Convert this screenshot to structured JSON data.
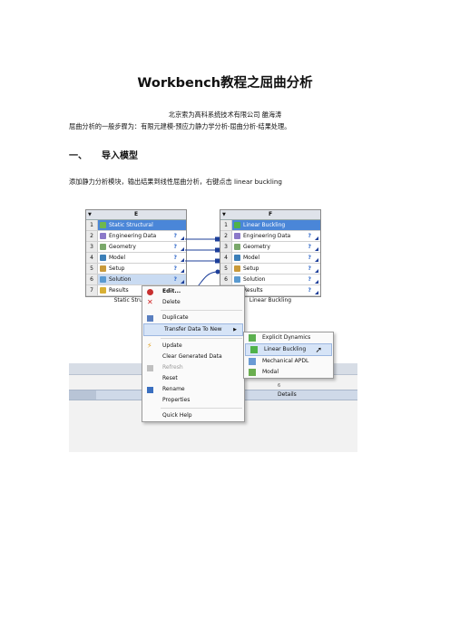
{
  "doc": {
    "title": "Workbench教程之屈曲分析",
    "author": "北京索为高科系统技术有限公司  雒海涛",
    "intro": "屈曲分析的一般步骤为：有限元建模-预应力静力学分析-屈曲分析-结果处理。",
    "section_num": "一、",
    "section_title": "导入模型",
    "para_cn": "添加静力分析模块，输出结果到线性屈曲分析，右键点击 ",
    "para_en": "linear buckling"
  },
  "screenshot": {
    "system_e": {
      "col_label": "E",
      "caption": "Static Structural",
      "rows": [
        {
          "n": "1",
          "label": "Static Structural",
          "status": ""
        },
        {
          "n": "2",
          "label": "Engineering Data",
          "status": "?"
        },
        {
          "n": "3",
          "label": "Geometry",
          "status": "?"
        },
        {
          "n": "4",
          "label": "Model",
          "status": "?"
        },
        {
          "n": "5",
          "label": "Setup",
          "status": "?"
        },
        {
          "n": "6",
          "label": "Solution",
          "status": "?"
        },
        {
          "n": "7",
          "label": "Results",
          "status": "?"
        }
      ]
    },
    "system_f": {
      "col_label": "F",
      "caption": "Linear Buckling",
      "rows": [
        {
          "n": "1",
          "label": "Linear Buckling",
          "status": ""
        },
        {
          "n": "2",
          "label": "Engineering Data",
          "status": "?"
        },
        {
          "n": "3",
          "label": "Geometry",
          "status": "?"
        },
        {
          "n": "4",
          "label": "Model",
          "status": "?"
        },
        {
          "n": "5",
          "label": "Setup",
          "status": "?"
        },
        {
          "n": "6",
          "label": "Solution",
          "status": "?"
        },
        {
          "n": "7",
          "label": "Results",
          "status": "?"
        }
      ]
    },
    "context_menu": {
      "edit": "Edit...",
      "delete": "Delete",
      "duplicate": "Duplicate",
      "transfer": "Transfer Data To New",
      "update": "Update",
      "clear": "Clear Generated Data",
      "refresh": "Refresh",
      "reset": "Reset",
      "rename": "Rename",
      "properties": "Properties",
      "quick_help": "Quick Help"
    },
    "submenu": {
      "explicit": "Explicit Dynamics",
      "linear_buckling": "Linear Buckling",
      "mechanical_apdl": "Mechanical APDL",
      "modal": "Modal"
    },
    "details_label": "Details",
    "details_num": "6"
  }
}
